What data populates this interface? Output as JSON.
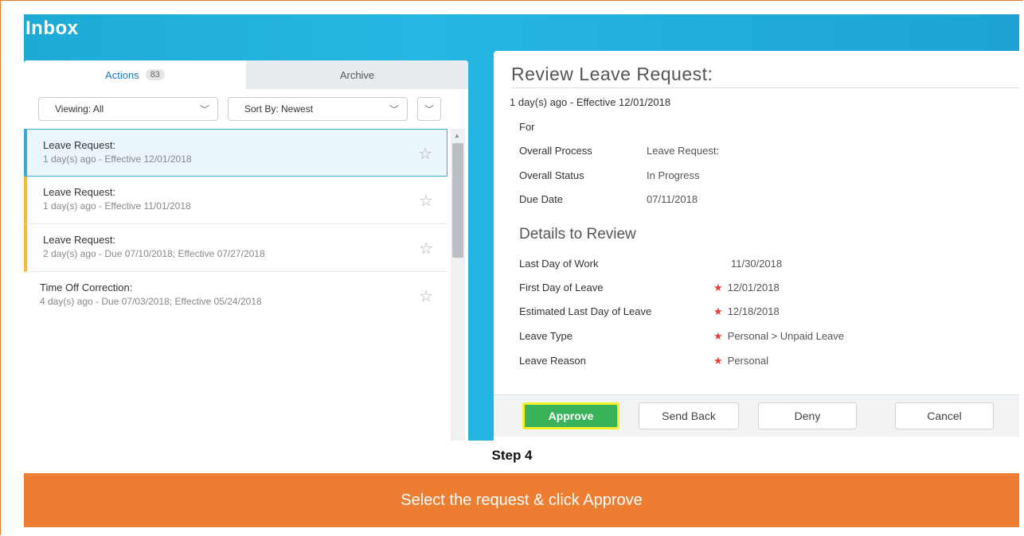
{
  "inbox_title": "Inbox",
  "tabs": [
    {
      "label": "Actions",
      "badge": "83"
    },
    {
      "label": "Archive"
    }
  ],
  "filters": {
    "viewing": "Viewing: All",
    "sort": "Sort By: Newest"
  },
  "items": [
    {
      "title": "Leave Request:",
      "subtitle": "1 day(s) ago - Effective 12/01/2018"
    },
    {
      "title": "Leave Request:",
      "subtitle": "1 day(s) ago - Effective 11/01/2018"
    },
    {
      "title": "Leave Request:",
      "subtitle": "2 day(s) ago - Due 07/10/2018; Effective 07/27/2018"
    },
    {
      "title": "Time Off Correction:",
      "subtitle": "4 day(s) ago - Due 07/03/2018; Effective 05/24/2018"
    }
  ],
  "detail": {
    "title": "Review  Leave Request:",
    "subtitle": "1 day(s) ago - Effective 12/01/2018",
    "for_label": "For",
    "overall_process_label": "Overall Process",
    "overall_process_value": "Leave Request:",
    "overall_status_label": "Overall Status",
    "overall_status_value": "In Progress",
    "due_date_label": "Due Date",
    "due_date_value": "07/11/2018",
    "section_title": "Details to Review",
    "rows": [
      {
        "label": "Last Day of Work",
        "value": "11/30/2018",
        "required": false
      },
      {
        "label": "First Day of Leave",
        "value": "12/01/2018",
        "required": true
      },
      {
        "label": "Estimated Last Day of Leave",
        "value": "12/18/2018",
        "required": true
      },
      {
        "label": "Leave Type",
        "value": "Personal > Unpaid Leave",
        "required": true
      },
      {
        "label": "Leave Reason",
        "value": "Personal",
        "required": true
      }
    ],
    "required_mark": "★"
  },
  "buttons": {
    "approve": "Approve",
    "send_back": "Send Back",
    "deny": "Deny",
    "cancel": "Cancel"
  },
  "step_label": "Step 4",
  "banner_text": "Select the request & click Approve",
  "colors": {
    "accent": "#1faad6",
    "approve": "#3ab35a",
    "banner": "#ed7d31",
    "highlight": "#f7f226"
  }
}
